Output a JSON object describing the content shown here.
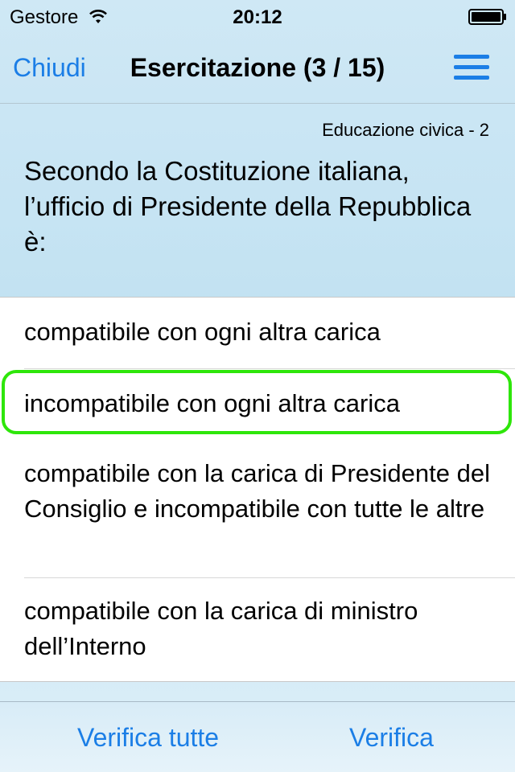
{
  "status_bar": {
    "carrier": "Gestore",
    "time": "20:12",
    "wifi_icon": "wifi-icon",
    "battery_icon": "battery-full-icon"
  },
  "nav": {
    "close_label": "Chiudi",
    "title": "Esercitazione (3 / 15)",
    "menu_icon": "hamburger-menu-icon"
  },
  "question": {
    "category": "Educazione civica - 2",
    "text": "Secondo la Costituzione italiana, l’ufficio di Presidente della Repubblica è:"
  },
  "answers": [
    {
      "text": "compatibile con ogni altra carica",
      "selected": false
    },
    {
      "text": "incompatibile con ogni altra carica",
      "selected": true
    },
    {
      "text": "compatibile con la carica di Presidente del Consiglio e incompatibile con tutte le altre",
      "selected": false
    },
    {
      "text": "compatibile con la carica di ministro dell’Interno",
      "selected": false
    }
  ],
  "toolbar": {
    "verify_all_label": "Verifica tutte",
    "verify_label": "Verifica"
  },
  "colors": {
    "accent": "#1b7ee6",
    "selected_border": "#2ee60a"
  }
}
